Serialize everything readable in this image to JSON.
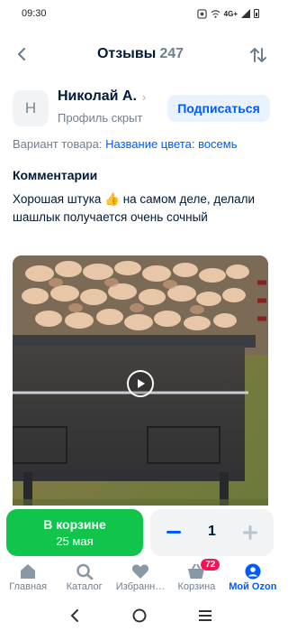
{
  "status_bar": {
    "time": "09:30",
    "network": "4G+",
    "icons": [
      "notification-icon",
      "vowifi-icon",
      "signal-icon",
      "battery-icon"
    ]
  },
  "header": {
    "title": "Отзывы",
    "count": "247",
    "back_icon": "chevron-left-icon",
    "sort_icon": "sort-arrows-icon"
  },
  "review": {
    "avatar_initial": "Н",
    "author": "Николай А.",
    "author_sub": "Профиль скрыт",
    "subscribe_label": "Подписаться",
    "variant_label": "Вариант товара:",
    "variant_value": "Название цвета: восемь",
    "comments_title": "Комментарии",
    "comment_text": "Хорошая штука 👍 на самом деле, делали шашлык получается очень сочный",
    "media_type": "video"
  },
  "cart": {
    "in_cart_label": "В корзине",
    "delivery_date": "25 мая",
    "quantity": "1",
    "minus_label": "−",
    "plus_label": "+"
  },
  "tabs": [
    {
      "label": "Главная",
      "icon": "home-icon",
      "active": false
    },
    {
      "label": "Каталог",
      "icon": "search-icon",
      "active": false
    },
    {
      "label": "Избранн…",
      "icon": "heart-icon",
      "active": false
    },
    {
      "label": "Корзина",
      "icon": "basket-icon",
      "badge": "72",
      "active": false
    },
    {
      "label": "Мой Ozon",
      "icon": "profile-icon",
      "active": true
    }
  ],
  "colors": {
    "accent": "#005bff",
    "green": "#10c44c",
    "badge": "#f91155",
    "text_secondary": "#707f8d"
  }
}
